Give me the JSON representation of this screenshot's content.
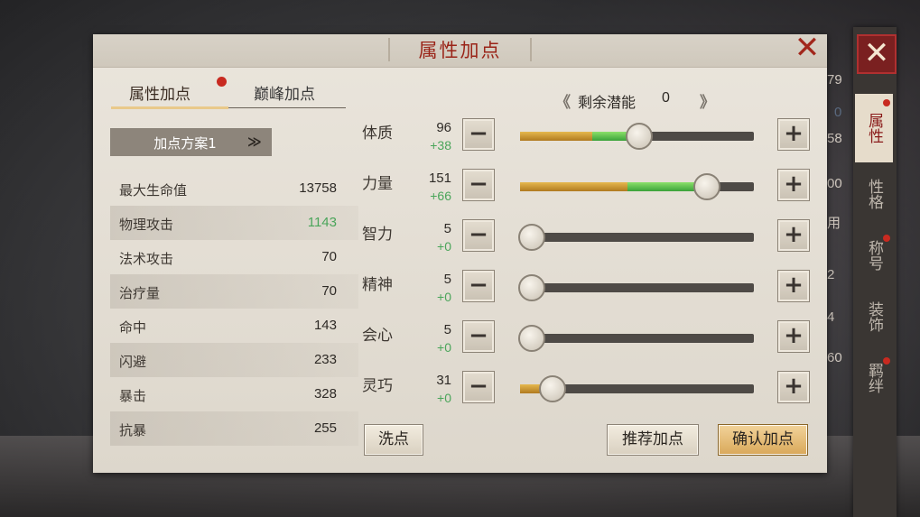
{
  "dialog": {
    "title": "属性加点",
    "tabs": [
      {
        "label": "属性加点",
        "active": true
      },
      {
        "label": "巅峰加点",
        "active": false
      }
    ],
    "scheme_dropdown": "加点方案1",
    "remaining_label": "剩余潜能",
    "remaining_value": "0",
    "stats": [
      {
        "name": "最大生命值",
        "value": "13758"
      },
      {
        "name": "物理攻击",
        "value": "1143"
      },
      {
        "name": "法术攻击",
        "value": "70"
      },
      {
        "name": "治疗量",
        "value": "70"
      },
      {
        "name": "命中",
        "value": "143"
      },
      {
        "name": "闪避",
        "value": "233"
      },
      {
        "name": "暴击",
        "value": "328"
      },
      {
        "name": "抗暴",
        "value": "255"
      }
    ],
    "attributes": [
      {
        "name": "体质",
        "value": "96",
        "bonus": "+38",
        "base_fraction": 0.31,
        "total_fraction": 0.51
      },
      {
        "name": "力量",
        "value": "151",
        "bonus": "+66",
        "base_fraction": 0.46,
        "total_fraction": 0.8
      },
      {
        "name": "智力",
        "value": "5",
        "bonus": "+0",
        "base_fraction": 0.0,
        "total_fraction": 0.0
      },
      {
        "name": "精神",
        "value": "5",
        "bonus": "+0",
        "base_fraction": 0.0,
        "total_fraction": 0.0
      },
      {
        "name": "会心",
        "value": "5",
        "bonus": "+0",
        "base_fraction": 0.0,
        "total_fraction": 0.0
      },
      {
        "name": "灵巧",
        "value": "31",
        "bonus": "+0",
        "base_fraction": 0.14,
        "total_fraction": 0.14
      }
    ],
    "buttons": {
      "reset": "洗点",
      "recommend": "推荐加点",
      "confirm": "确认加点"
    }
  },
  "side_panel": {
    "tabs": [
      "属性",
      "性格",
      "称号",
      "装饰",
      "羁绊"
    ]
  },
  "background_numbers": [
    "79",
    "0",
    "58",
    "00",
    "用",
    "2",
    "4",
    "60"
  ],
  "colors": {
    "title_red": "#9a2418",
    "bonus_green": "#4aa55a",
    "slider_gold": "#c8962e",
    "slider_green": "#5cc24a",
    "confirm_gold": "#d9a85a"
  }
}
